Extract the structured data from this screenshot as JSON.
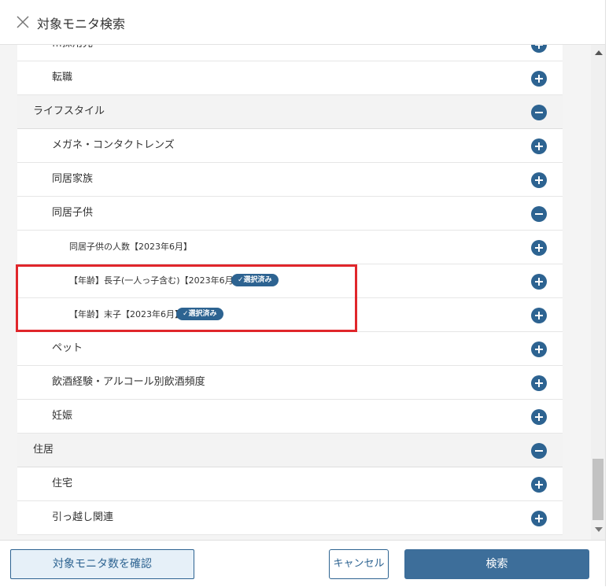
{
  "header": {
    "title": "対象モニタ検索"
  },
  "rows": [
    {
      "label": "…採用先",
      "level": "l2",
      "state": "plus"
    },
    {
      "label": "転職",
      "level": "l2",
      "state": "plus"
    },
    {
      "label": "ライフスタイル",
      "level": "group",
      "state": "minus"
    },
    {
      "label": "メガネ・コンタクトレンズ",
      "level": "l2",
      "state": "plus"
    },
    {
      "label": "同居家族",
      "level": "l2",
      "state": "plus"
    },
    {
      "label": "同居子供",
      "level": "l2",
      "state": "minus"
    },
    {
      "label": "同居子供の人数【2023年6月】",
      "level": "l3",
      "state": "plus"
    },
    {
      "label": "【年齢】長子(一人っ子含む)【2023年6月】",
      "level": "l3",
      "state": "plus",
      "badge": "✓選択済み"
    },
    {
      "label": "【年齢】末子【2023年6月】",
      "level": "l3",
      "state": "plus",
      "badge": "✓選択済み"
    },
    {
      "label": "ペット",
      "level": "l2",
      "state": "plus"
    },
    {
      "label": "飲酒経験・アルコール別飲酒頻度",
      "level": "l2",
      "state": "plus"
    },
    {
      "label": "妊娠",
      "level": "l2",
      "state": "plus"
    },
    {
      "label": "住居",
      "level": "group",
      "state": "minus"
    },
    {
      "label": "住宅",
      "level": "l2",
      "state": "plus"
    },
    {
      "label": "引っ越し関連",
      "level": "l2",
      "state": "plus"
    }
  ],
  "footer": {
    "confirm_label": "対象モニタ数を確認",
    "cancel_label": "キャンセル",
    "search_label": "検索"
  },
  "colors": {
    "accent": "#2d6391",
    "highlight": "#e0262b",
    "group_bg": "#f3f3f3"
  },
  "icons": {
    "close": "close-icon",
    "expand": "plus-circle-icon",
    "collapse": "minus-circle-icon"
  }
}
